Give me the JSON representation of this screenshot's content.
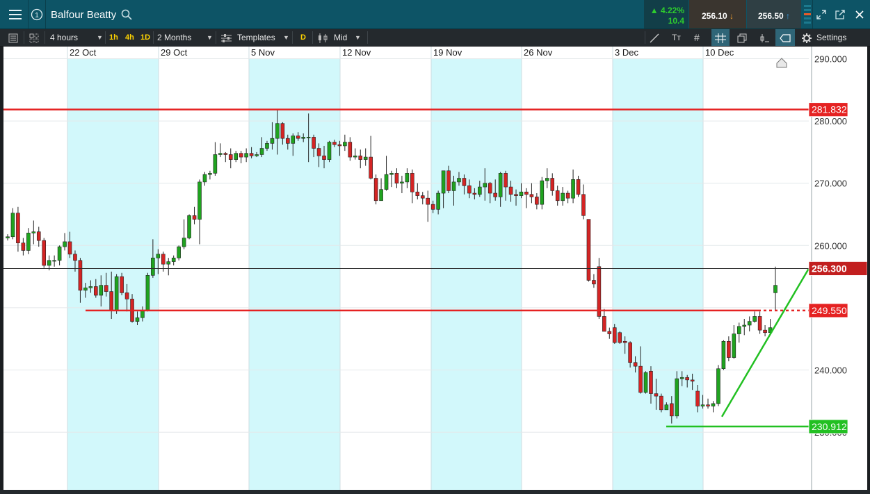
{
  "header": {
    "menu_icon": "hamburger-menu-icon",
    "badge": "1",
    "title": "Balfour Beatty",
    "search_icon": "search-icon",
    "change_pct": "4.22%",
    "change_abs": "10.4",
    "sell_price": "256.10",
    "buy_price": "256.50",
    "colors": {
      "up": "#2ecc2e",
      "sell_arrow": "#f0a030",
      "buy_arrow": "#3aa0e8"
    }
  },
  "toolbar": {
    "interval": "4 hours",
    "quick_1h": "1h",
    "quick_4h": "4h",
    "quick_1d": "1D",
    "range": "2 Months",
    "templates": "Templates",
    "d_badge": "D",
    "price_type": "Mid",
    "tt_label": "Tт",
    "settings": "Settings"
  },
  "chart_data": {
    "type": "candlestick",
    "x_tick_labels": [
      "22 Oct",
      "29 Oct",
      "5 Nov",
      "12 Nov",
      "19 Nov",
      "26 Nov",
      "3 Dec",
      "10 Dec"
    ],
    "y_tick_labels": [
      "230.000",
      "240.000",
      "260.000",
      "270.000",
      "280.000",
      "290.000"
    ],
    "ylim": [
      221,
      290.5
    ],
    "current_price": 256.3,
    "current_price_label": "256.300",
    "levels": [
      {
        "value": 281.832,
        "label": "281.832",
        "color": "#e52222"
      },
      {
        "value": 249.55,
        "label": "249.550",
        "color": "#e52222"
      },
      {
        "value": 230.912,
        "label": "230.912",
        "color": "#22c022"
      }
    ],
    "up_color": "#1fa31f",
    "down_color": "#d42424",
    "week_shade_color": "#d2f8fb",
    "candles": [
      [
        261.2,
        261.8,
        260.8,
        261.4
      ],
      [
        261.4,
        266,
        261,
        265.2
      ],
      [
        265.2,
        266.2,
        259,
        260.4
      ],
      [
        260.4,
        261.2,
        258.4,
        259.2
      ],
      [
        259.2,
        262.8,
        258.6,
        262
      ],
      [
        262,
        264,
        260.2,
        262.2
      ],
      [
        262.2,
        263,
        259.8,
        260.8
      ],
      [
        260.8,
        261.2,
        256.4,
        256.8
      ],
      [
        256.8,
        258.4,
        256,
        257.6
      ],
      [
        257.6,
        258.4,
        256.6,
        257.6
      ],
      [
        257.6,
        260,
        256.8,
        259.8
      ],
      [
        259.8,
        262,
        259.2,
        260.6
      ],
      [
        260.6,
        262.2,
        258,
        258.6
      ],
      [
        258.6,
        259.2,
        255.8,
        257.6
      ],
      [
        257.6,
        258,
        250.8,
        252.8
      ],
      [
        252.8,
        254,
        251.6,
        253.2
      ],
      [
        253.2,
        254.4,
        252.4,
        253.4
      ],
      [
        253.4,
        254.6,
        251.6,
        252
      ],
      [
        252,
        255.2,
        250.2,
        253.6
      ],
      [
        253.6,
        255.6,
        251.8,
        252.6
      ],
      [
        252.6,
        255.8,
        248.2,
        249.6
      ],
      [
        249.6,
        255.4,
        249,
        255
      ],
      [
        255,
        255.6,
        252,
        252.4
      ],
      [
        252.4,
        253.8,
        249.4,
        251.4
      ],
      [
        251.4,
        252.2,
        247.6,
        247.8
      ],
      [
        247.8,
        249.4,
        247.2,
        248.4
      ],
      [
        248.4,
        250.2,
        247.8,
        249.6
      ],
      [
        249.6,
        255.6,
        249.4,
        255.2
      ],
      [
        255.2,
        261,
        254.8,
        258
      ],
      [
        258,
        259.4,
        255.4,
        258.6
      ],
      [
        258.6,
        259,
        255.8,
        257
      ],
      [
        257,
        258,
        255.2,
        257.4
      ],
      [
        257.4,
        258.4,
        256.8,
        258
      ],
      [
        258,
        260,
        257.6,
        259.8
      ],
      [
        259.8,
        264.2,
        259.4,
        261.2
      ],
      [
        261.2,
        265,
        261,
        264.8
      ],
      [
        264.8,
        266.2,
        263.4,
        264.2
      ],
      [
        264.2,
        270.6,
        260.2,
        270.2
      ],
      [
        270.2,
        271.8,
        269.6,
        271.4
      ],
      [
        271.4,
        272,
        270.6,
        271.6
      ],
      [
        271.6,
        276.6,
        271.2,
        274.6
      ],
      [
        274.6,
        276.4,
        274.2,
        274.8
      ],
      [
        274.8,
        275,
        273.4,
        274.6
      ],
      [
        274.6,
        275.6,
        272.4,
        273.8
      ],
      [
        273.8,
        275.2,
        273.4,
        274.8
      ],
      [
        274.8,
        275.2,
        273.2,
        274.2
      ],
      [
        274.2,
        275.6,
        273.4,
        274.8
      ],
      [
        274.8,
        275.8,
        274,
        274.4
      ],
      [
        274.4,
        275,
        274.2,
        274.6
      ],
      [
        274.6,
        277.4,
        274.2,
        275.6
      ],
      [
        275.6,
        276.8,
        275.2,
        276.4
      ],
      [
        276.4,
        279.8,
        275.4,
        277.2
      ],
      [
        277.2,
        281.8,
        274.6,
        279.6
      ],
      [
        279.6,
        279.8,
        276.2,
        277.2
      ],
      [
        277.2,
        277.8,
        275.4,
        276.4
      ],
      [
        276.4,
        278,
        274.4,
        277.6
      ],
      [
        277.6,
        278.2,
        276.8,
        277.2
      ],
      [
        277.2,
        278,
        276.6,
        277.4
      ],
      [
        277.4,
        281.2,
        273.4,
        277.4
      ],
      [
        277.4,
        277.8,
        274.2,
        275.6
      ],
      [
        275.6,
        276.4,
        272.6,
        274.4
      ],
      [
        274.4,
        276,
        272.4,
        273.8
      ],
      [
        273.8,
        276.8,
        273.4,
        276.6
      ],
      [
        276.6,
        277,
        275.8,
        276.2
      ],
      [
        276.2,
        276.8,
        274.4,
        276
      ],
      [
        276,
        277.8,
        275.2,
        276.6
      ],
      [
        276.6,
        277.4,
        273.6,
        274.2
      ],
      [
        274.2,
        275.6,
        273.8,
        274.4
      ],
      [
        274.4,
        275.4,
        272.4,
        273.8
      ],
      [
        273.8,
        275.6,
        272.8,
        274.2
      ],
      [
        274.2,
        277.6,
        270.6,
        270.8
      ],
      [
        270.8,
        271.4,
        266.6,
        267.2
      ],
      [
        267.2,
        270.8,
        267.4,
        269
      ],
      [
        269,
        274.4,
        268.8,
        271.4
      ],
      [
        271.4,
        272,
        269.4,
        271.6
      ],
      [
        271.6,
        272.4,
        269.2,
        270
      ],
      [
        270,
        271.2,
        268.4,
        270.2
      ],
      [
        270.2,
        272.4,
        269.2,
        271.6
      ],
      [
        271.6,
        272.2,
        266.8,
        268.6
      ],
      [
        268.6,
        270,
        267.4,
        268
      ],
      [
        268,
        268.6,
        266.6,
        267.6
      ],
      [
        267.6,
        268.8,
        263.8,
        266.6
      ],
      [
        266.6,
        267.2,
        265.2,
        265.8
      ],
      [
        265.8,
        268.8,
        265,
        268.4
      ],
      [
        268.4,
        271.8,
        266,
        272
      ],
      [
        272,
        272.8,
        268.4,
        268.8
      ],
      [
        268.8,
        271.2,
        266.4,
        270.2
      ],
      [
        270.2,
        271.8,
        269.6,
        270.8
      ],
      [
        270.8,
        271.4,
        268.2,
        269.6
      ],
      [
        269.6,
        270.6,
        267.6,
        268.4
      ],
      [
        268.4,
        269.2,
        267.4,
        268.2
      ],
      [
        268.2,
        270.4,
        267.8,
        269.4
      ],
      [
        269.4,
        272.4,
        267.2,
        270
      ],
      [
        270,
        270.2,
        266.8,
        268.4
      ],
      [
        268.4,
        270.6,
        267.2,
        267.8
      ],
      [
        267.8,
        271.8,
        266.2,
        271.6
      ],
      [
        271.6,
        272,
        267.2,
        269.4
      ],
      [
        269.4,
        270.4,
        267,
        268.2
      ],
      [
        268.2,
        269,
        266.4,
        268
      ],
      [
        268,
        270,
        267.6,
        268.6
      ],
      [
        268.6,
        269.2,
        266,
        268.2
      ],
      [
        268.2,
        270,
        266.8,
        267.8
      ],
      [
        267.8,
        268.4,
        265.8,
        266.6
      ],
      [
        266.6,
        271,
        265.8,
        270.4
      ],
      [
        270.4,
        272.4,
        269.2,
        270.8
      ],
      [
        270.8,
        271.6,
        268,
        268.8
      ],
      [
        268.8,
        269.6,
        266.4,
        267.2
      ],
      [
        267.2,
        269.4,
        266.4,
        268.4
      ],
      [
        268.4,
        268.8,
        266.8,
        267.6
      ],
      [
        267.6,
        272.2,
        266.8,
        270.6
      ],
      [
        270.6,
        271.2,
        267.8,
        268.2
      ],
      [
        268.2,
        269.8,
        264.2,
        264.8
      ],
      [
        264.2,
        264.2,
        254.2,
        254.4
      ],
      [
        254.4,
        255.4,
        253.2,
        253.8
      ],
      [
        256.6,
        258,
        248.2,
        248.6
      ],
      [
        248.6,
        249.8,
        246.2,
        246.2
      ],
      [
        246.2,
        246.8,
        245,
        245.8
      ],
      [
        246.8,
        247.4,
        244.2,
        244.4
      ],
      [
        246,
        246.2,
        244.2,
        244.4
      ],
      [
        244.6,
        245.4,
        242.6,
        244.4
      ],
      [
        244.4,
        244.6,
        240.4,
        241.2
      ],
      [
        241.2,
        242.2,
        239.6,
        240.6
      ],
      [
        240.6,
        243.8,
        236.2,
        236.4
      ],
      [
        236.4,
        239.8,
        236.2,
        239.6
      ],
      [
        239.8,
        240.6,
        234.6,
        236.2
      ],
      [
        236.2,
        238.6,
        233.6,
        235.8
      ],
      [
        235.8,
        236.2,
        233.2,
        233.6
      ],
      [
        233.6,
        234.8,
        233.8,
        234.4
      ],
      [
        234.6,
        235.8,
        231.4,
        232.6
      ],
      [
        232.6,
        239.8,
        232.2,
        238.6
      ],
      [
        238.6,
        239.8,
        237.4,
        238.8
      ],
      [
        238.8,
        239.2,
        237.2,
        238.4
      ],
      [
        238.4,
        239.4,
        236.8,
        238.2
      ],
      [
        236.6,
        237.6,
        233.2,
        234.2
      ],
      [
        234.2,
        236,
        233.8,
        234.4
      ],
      [
        234.4,
        235.4,
        233.8,
        234.2
      ],
      [
        234.2,
        235,
        233.2,
        234.6
      ],
      [
        234.6,
        240.8,
        234.2,
        240.2
      ],
      [
        240.2,
        244.8,
        240,
        244.6
      ],
      [
        244.6,
        245.4,
        241.4,
        242
      ],
      [
        242,
        247.2,
        241.8,
        245.8
      ],
      [
        245.8,
        247.6,
        244.4,
        247
      ],
      [
        247,
        248.2,
        245.6,
        247.2
      ],
      [
        247.2,
        248.6,
        246.2,
        247.8
      ],
      [
        247.8,
        249.4,
        247.6,
        248.6
      ],
      [
        248.6,
        249.4,
        245.8,
        246.4
      ],
      [
        246.4,
        247.2,
        245.4,
        246
      ],
      [
        246,
        248.2,
        245.6,
        246.8
      ],
      [
        252.4,
        256.6,
        249.6,
        253.6
      ]
    ]
  }
}
